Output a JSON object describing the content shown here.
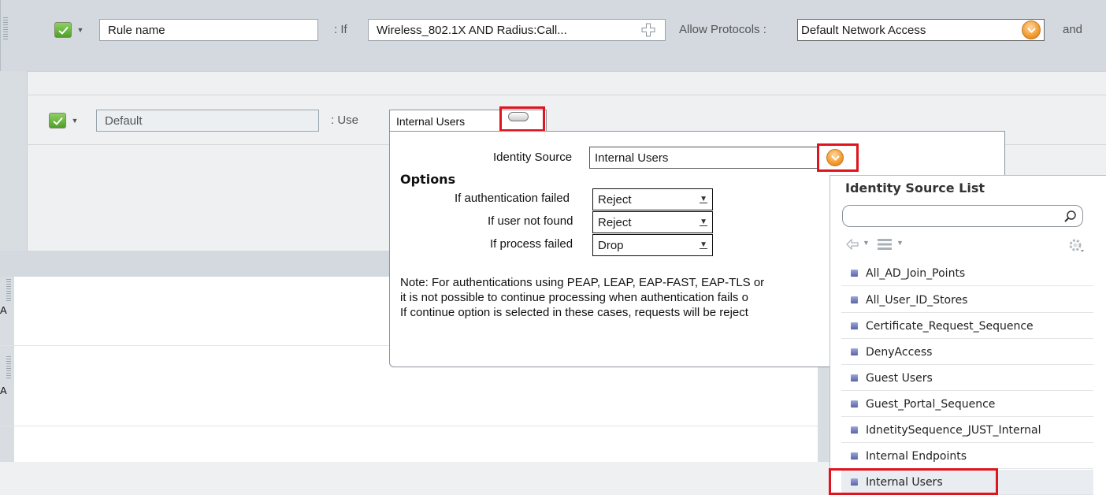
{
  "rule": {
    "name_value": "Rule name",
    "if_label": ": If",
    "condition_value": "Wireless_802.1X AND Radius:Call...",
    "allow_protocols_label": "Allow Protocols :",
    "allow_protocols_value": "Default Network Access",
    "and_label": "and"
  },
  "default_rule": {
    "name_value": "Default",
    "use_label": ": Use",
    "identity_value": "Internal Users"
  },
  "popup": {
    "identity_source_label": "Identity Source",
    "identity_source_value": "Internal Users",
    "options_heading": "Options",
    "auth_failed_label": "If authentication failed",
    "auth_failed_value": "Reject",
    "user_not_found_label": "If user not found",
    "user_not_found_value": "Reject",
    "process_failed_label": "If process failed",
    "process_failed_value": "Drop",
    "note_line1": "Note: For authentications using PEAP, LEAP, EAP-FAST, EAP-TLS or",
    "note_line2": "it is not possible to continue processing when authentication fails o",
    "note_line3": "If continue option is selected in these cases, requests will be reject"
  },
  "source_list": {
    "title": "Identity Source List",
    "search_placeholder": "",
    "items": [
      "All_AD_Join_Points",
      "All_User_ID_Stores",
      "Certificate_Request_Sequence",
      "DenyAccess",
      "Guest Users",
      "Guest_Portal_Sequence",
      "IdnetitySequence_JUST_Internal",
      "Internal Endpoints",
      "Internal Users"
    ],
    "selected_item": "Internal Users"
  },
  "background": {
    "row_label_1": "A",
    "row_label_2": "A"
  },
  "colors": {
    "highlight_red": "#e0141e",
    "accent_orange": "#f29a2e",
    "check_green": "#4f9f2a"
  }
}
